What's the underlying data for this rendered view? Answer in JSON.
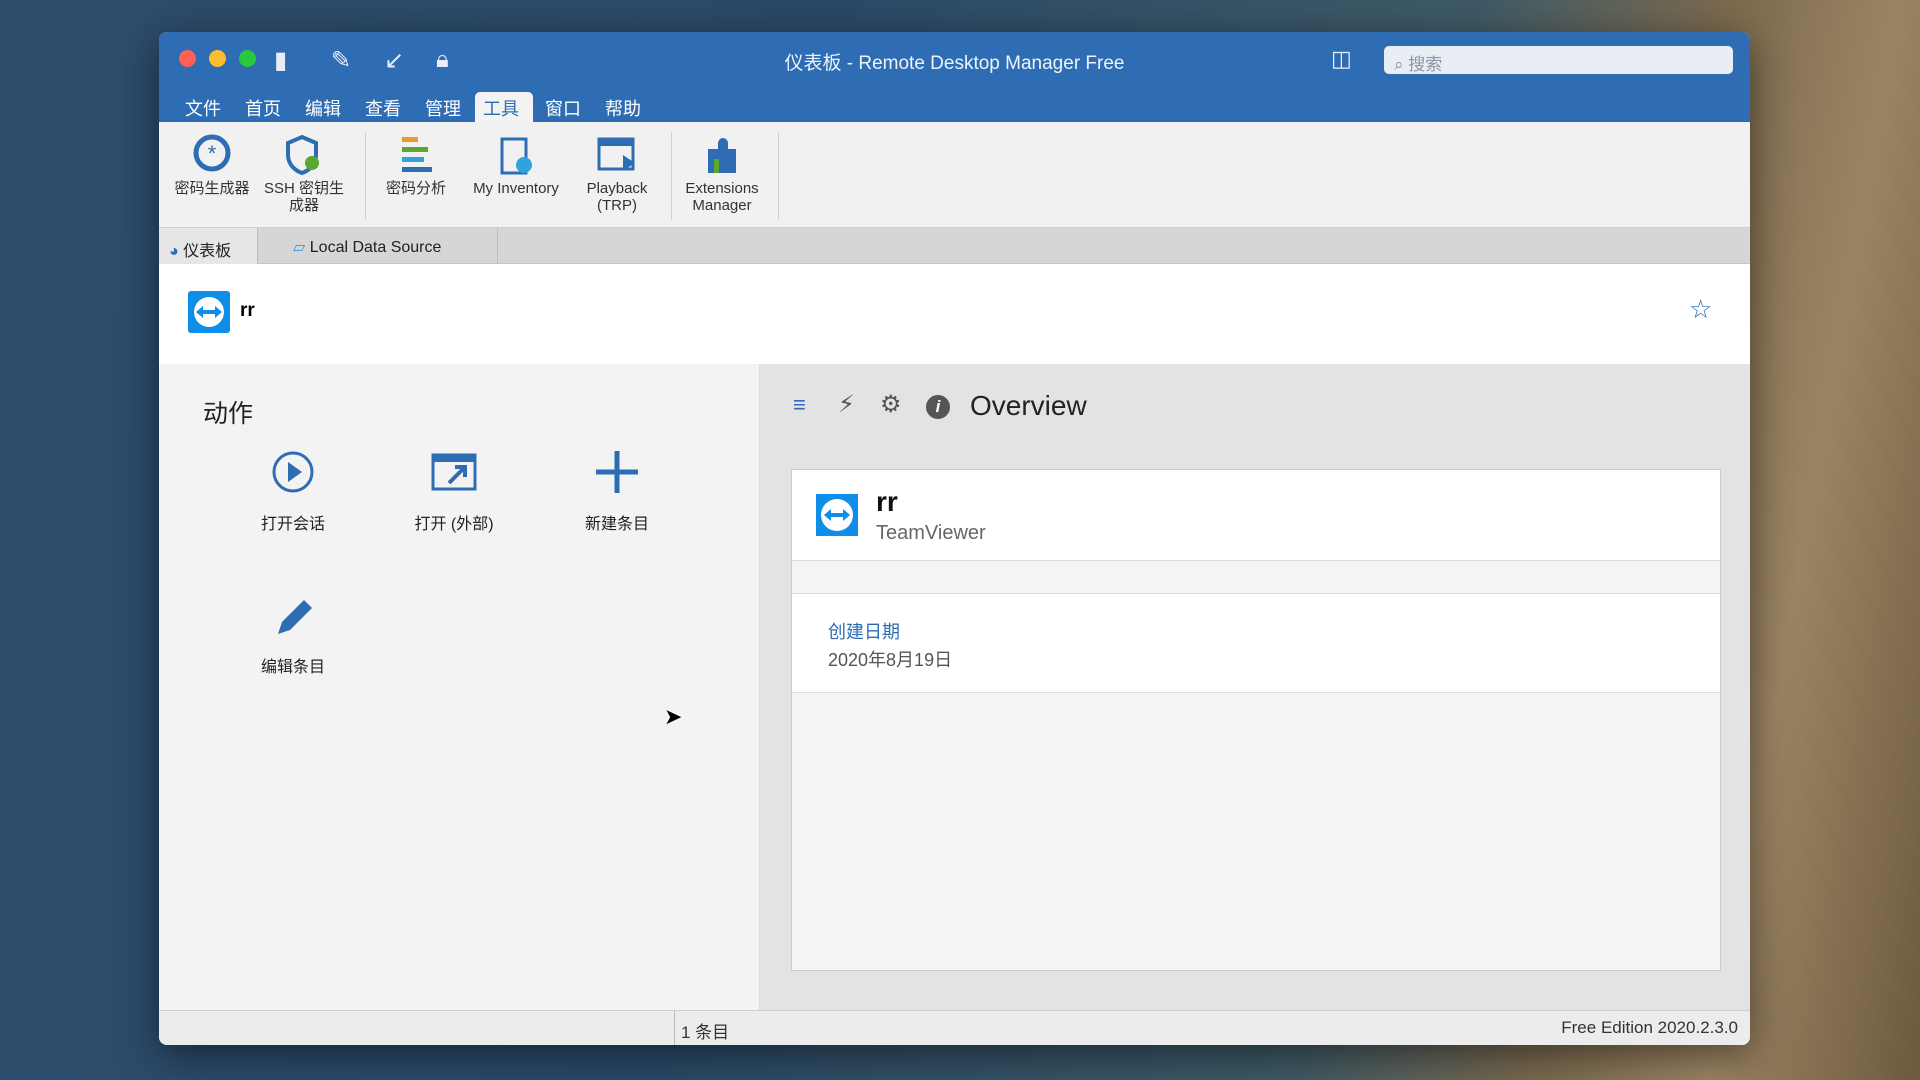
{
  "window": {
    "title": "仪表板 - Remote Desktop Manager Free",
    "search_placeholder": "搜索"
  },
  "menu": [
    {
      "label": "文件"
    },
    {
      "label": "首页"
    },
    {
      "label": "编辑"
    },
    {
      "label": "查看"
    },
    {
      "label": "管理"
    },
    {
      "label": "工具",
      "active": true
    },
    {
      "label": "窗口"
    },
    {
      "label": "帮助"
    }
  ],
  "toolbar": [
    {
      "label": "密码生成器",
      "icon": "password-generator-icon"
    },
    {
      "label": "SSH 密钥生成器",
      "icon": "ssh-key-icon"
    },
    {
      "label": "密码分析",
      "icon": "password-analyzer-icon"
    },
    {
      "label": "My Inventory",
      "icon": "inventory-icon"
    },
    {
      "label": "Playback (TRP)",
      "icon": "playback-icon"
    },
    {
      "label": "Extensions Manager",
      "icon": "puzzle-icon"
    }
  ],
  "tabs": [
    {
      "label": "仪表板"
    },
    {
      "label": "Local Data Source"
    }
  ],
  "entry": {
    "name": "rr",
    "type": "TeamViewer"
  },
  "actions": {
    "title": "动作",
    "items": [
      {
        "label": "打开会话"
      },
      {
        "label": "打开 (外部)"
      },
      {
        "label": "新建条目"
      },
      {
        "label": "编辑条目"
      }
    ]
  },
  "overview": {
    "title": "Overview",
    "created_label": "创建日期",
    "created_value": "2020年8月19日"
  },
  "status": {
    "count": "1 条目",
    "edition": "Free Edition 2020.2.3.0"
  },
  "colors": {
    "accent": "#2e6db4",
    "teamviewer": "#0e8ee9"
  }
}
